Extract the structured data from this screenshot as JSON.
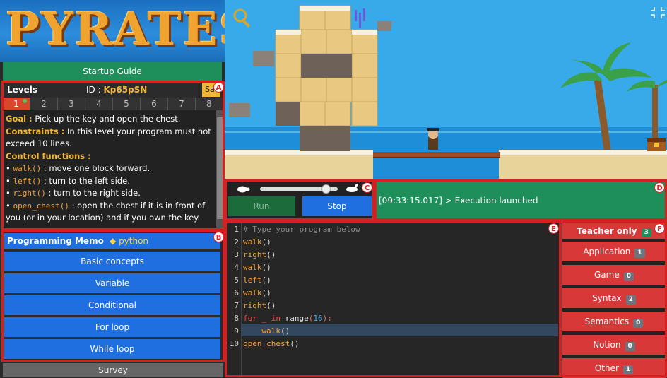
{
  "app": {
    "logo_text": "PYRATES",
    "startup_guide": "Startup Guide",
    "survey": "Survey"
  },
  "levels": {
    "label": "Levels",
    "id_label": "ID :",
    "id_value": "Kp65pSN",
    "save_label": "Sa",
    "tabs": [
      "1",
      "2",
      "3",
      "4",
      "5",
      "6",
      "7",
      "8"
    ],
    "active_tab": "1",
    "goal_label": "Goal :",
    "goal_text": "Pick up the key and open the chest.",
    "constraints_label": "Constraints :",
    "constraints_text": "In this level your program must not exceed 10 lines.",
    "control_label": "Control functions :",
    "functions": [
      {
        "name": "walk",
        "desc": ": move one block forward."
      },
      {
        "name": "left",
        "desc": ": turn to the left side."
      },
      {
        "name": "right",
        "desc": ": turn to the right side."
      },
      {
        "name": "open_chest",
        "desc": ": open the chest if it is in front of you (or in your location) and if you own the key."
      }
    ]
  },
  "memo": {
    "title": "Programming Memo",
    "python": "python",
    "items": [
      "Basic concepts",
      "Variable",
      "Conditional",
      "For loop",
      "While loop"
    ]
  },
  "control": {
    "run": "Run",
    "stop": "Stop",
    "speed": 0.85
  },
  "console": {
    "text": "[09:33:15.017] > Execution launched"
  },
  "editor": {
    "lines": [
      "# Type your program below",
      "walk()",
      "right()",
      "walk()",
      "left()",
      "walk()",
      "right()",
      "for _ in range(16):",
      "    walk()",
      "open_chest()"
    ],
    "current_line": 9
  },
  "teacher": {
    "title": "Teacher only",
    "count": "3",
    "items": [
      {
        "label": "Application",
        "count": "1"
      },
      {
        "label": "Game",
        "count": "0"
      },
      {
        "label": "Syntax",
        "count": "2"
      },
      {
        "label": "Semantics",
        "count": "0"
      },
      {
        "label": "Notion",
        "count": "0"
      },
      {
        "label": "Other",
        "count": "1"
      }
    ]
  },
  "markers": [
    "A",
    "B",
    "C",
    "D",
    "E",
    "F"
  ],
  "colors": {
    "accent_red": "#d81f1f",
    "blue": "#1f6fe0",
    "green": "#1e8f5a",
    "gold": "#f2b635"
  }
}
